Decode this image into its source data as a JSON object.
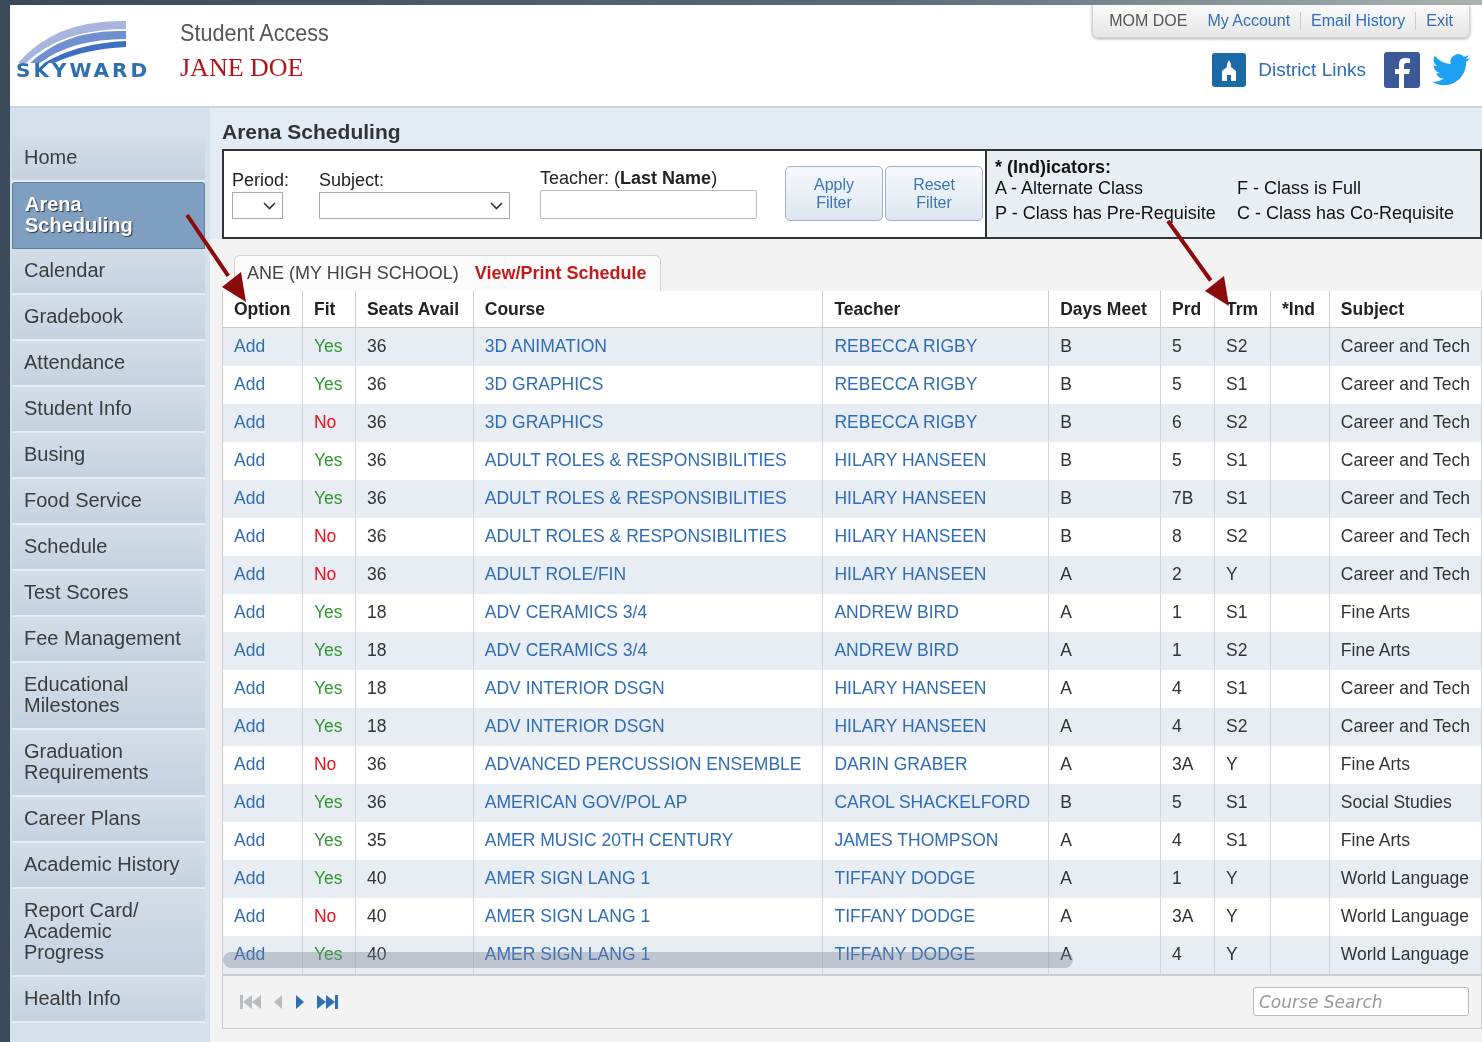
{
  "header": {
    "logo_text": "SKYWARD",
    "app_title": "Student Access",
    "student_name": "JANE DOE",
    "top_links": [
      {
        "label": "MOM DOE",
        "kind": "user"
      },
      {
        "label": "My Account",
        "kind": "link"
      },
      {
        "label": "Email History",
        "kind": "link"
      },
      {
        "label": "Exit",
        "kind": "link"
      }
    ],
    "district_links": "District Links"
  },
  "sidebar": {
    "items": [
      {
        "label": "Home",
        "selected": false
      },
      {
        "label": "Arena Scheduling",
        "selected": true
      },
      {
        "label": "Calendar",
        "selected": false
      },
      {
        "label": "Gradebook",
        "selected": false
      },
      {
        "label": "Attendance",
        "selected": false
      },
      {
        "label": "Student Info",
        "selected": false
      },
      {
        "label": "Busing",
        "selected": false
      },
      {
        "label": "Food Service",
        "selected": false
      },
      {
        "label": "Schedule",
        "selected": false
      },
      {
        "label": "Test Scores",
        "selected": false
      },
      {
        "label": "Fee Management",
        "selected": false
      },
      {
        "label": "Educational Milestones",
        "selected": false
      },
      {
        "label": "Graduation Requirements",
        "selected": false
      },
      {
        "label": "Career Plans",
        "selected": false
      },
      {
        "label": "Academic History",
        "selected": false
      },
      {
        "label": "Report Card/ Academic Progress",
        "selected": false
      },
      {
        "label": "Health Info",
        "selected": false
      }
    ]
  },
  "page_title": "Arena Scheduling",
  "filter": {
    "period_label": "Period:",
    "subject_label": "Subject:",
    "teacher_label": "Teacher: (**Last Name**)",
    "buttons": [
      "Apply Filter",
      "Reset Filter"
    ]
  },
  "indicators": {
    "title": "* (Ind)icators:",
    "items": [
      "A - Alternate Class",
      "F - Class is Full",
      "P - Class has Pre-Requisite",
      "C - Class has Co-Requisite"
    ]
  },
  "schedule_tab": {
    "label": "ANE (MY HIGH SCHOOL)",
    "link": "View/Print Schedule"
  },
  "table": {
    "columns": [
      "Option",
      "Fit",
      "Seats Avail",
      "Course",
      "Teacher",
      "Days Meet",
      "Prd",
      "Trm",
      "*Ind",
      "Subject"
    ],
    "rows": [
      {
        "option": "Add",
        "fit": "Yes",
        "fits": true,
        "seats": "36",
        "course": "3D ANIMATION",
        "teacher": "REBECCA RIGBY",
        "days": "B",
        "prd": "5",
        "trm": "S2",
        "subject": "Career and Tech"
      },
      {
        "option": "Add",
        "fit": "Yes",
        "fits": true,
        "seats": "36",
        "course": "3D GRAPHICS",
        "teacher": "REBECCA RIGBY",
        "days": "B",
        "prd": "5",
        "trm": "S1",
        "subject": "Career and Tech"
      },
      {
        "option": "Add",
        "fit": "No",
        "fits": false,
        "seats": "36",
        "course": "3D GRAPHICS",
        "teacher": "REBECCA RIGBY",
        "days": "B",
        "prd": "6",
        "trm": "S2",
        "subject": "Career and Tech"
      },
      {
        "option": "Add",
        "fit": "Yes",
        "fits": true,
        "seats": "36",
        "course": "ADULT ROLES & RESPONSIBILITIES",
        "teacher": "HILARY HANSEEN",
        "days": "B",
        "prd": "5",
        "trm": "S1",
        "subject": "Career and Tech"
      },
      {
        "option": "Add",
        "fit": "Yes",
        "fits": true,
        "seats": "36",
        "course": "ADULT ROLES & RESPONSIBILITIES",
        "teacher": "HILARY HANSEEN",
        "days": "B",
        "prd": "7B",
        "trm": "S1",
        "subject": "Career and Tech"
      },
      {
        "option": "Add",
        "fit": "No",
        "fits": false,
        "seats": "36",
        "course": "ADULT ROLES & RESPONSIBILITIES",
        "teacher": "HILARY HANSEEN",
        "days": "B",
        "prd": "8",
        "trm": "S2",
        "subject": "Career and Tech"
      },
      {
        "option": "Add",
        "fit": "No",
        "fits": false,
        "seats": "36",
        "course": "ADULT ROLE/FIN",
        "teacher": "HILARY HANSEEN",
        "days": "A",
        "prd": "2",
        "trm": "Y",
        "subject": "Career and Tech"
      },
      {
        "option": "Add",
        "fit": "Yes",
        "fits": true,
        "seats": "18",
        "course": "ADV CERAMICS 3/4",
        "teacher": "ANDREW BIRD",
        "days": "A",
        "prd": "1",
        "trm": "S1",
        "subject": "Fine Arts"
      },
      {
        "option": "Add",
        "fit": "Yes",
        "fits": true,
        "seats": "18",
        "course": "ADV CERAMICS 3/4",
        "teacher": "ANDREW BIRD",
        "days": "A",
        "prd": "1",
        "trm": "S2",
        "subject": "Fine Arts"
      },
      {
        "option": "Add",
        "fit": "Yes",
        "fits": true,
        "seats": "18",
        "course": "ADV INTERIOR DSGN",
        "teacher": "HILARY HANSEEN",
        "days": "A",
        "prd": "4",
        "trm": "S1",
        "subject": "Career and Tech"
      },
      {
        "option": "Add",
        "fit": "Yes",
        "fits": true,
        "seats": "18",
        "course": "ADV INTERIOR DSGN",
        "teacher": "HILARY HANSEEN",
        "days": "A",
        "prd": "4",
        "trm": "S2",
        "subject": "Career and Tech"
      },
      {
        "option": "Add",
        "fit": "No",
        "fits": false,
        "seats": "36",
        "course": "ADVANCED PERCUSSION ENSEMBLE",
        "teacher": "DARIN GRABER",
        "days": "A",
        "prd": "3A",
        "trm": "Y",
        "subject": "Fine Arts"
      },
      {
        "option": "Add",
        "fit": "Yes",
        "fits": true,
        "seats": "36",
        "course": "AMERICAN GOV/POL AP",
        "teacher": "CAROL SHACKELFORD",
        "days": "B",
        "prd": "5",
        "trm": "S1",
        "subject": "Social Studies"
      },
      {
        "option": "Add",
        "fit": "Yes",
        "fits": true,
        "seats": "35",
        "course": "AMER MUSIC 20TH CENTURY",
        "teacher": "JAMES THOMPSON",
        "days": "A",
        "prd": "4",
        "trm": "S1",
        "subject": "Fine Arts"
      },
      {
        "option": "Add",
        "fit": "Yes",
        "fits": true,
        "seats": "40",
        "course": "AMER SIGN LANG 1",
        "teacher": "TIFFANY DODGE",
        "days": "A",
        "prd": "1",
        "trm": "Y",
        "subject": "World Language"
      },
      {
        "option": "Add",
        "fit": "No",
        "fits": false,
        "seats": "40",
        "course": "AMER SIGN LANG 1",
        "teacher": "TIFFANY DODGE",
        "days": "A",
        "prd": "3A",
        "trm": "Y",
        "subject": "World Language"
      },
      {
        "option": "Add",
        "fit": "Yes",
        "fits": true,
        "seats": "40",
        "course": "AMER SIGN LANG 1",
        "teacher": "TIFFANY DODGE",
        "days": "A",
        "prd": "4",
        "trm": "Y",
        "subject": "World Language"
      }
    ]
  },
  "pager": {
    "buttons": [
      {
        "kind": "first",
        "disabled": true
      },
      {
        "kind": "prev",
        "disabled": true
      },
      {
        "kind": "next",
        "disabled": false
      },
      {
        "kind": "last",
        "disabled": false
      }
    ],
    "search_placeholder": "Course Search"
  }
}
